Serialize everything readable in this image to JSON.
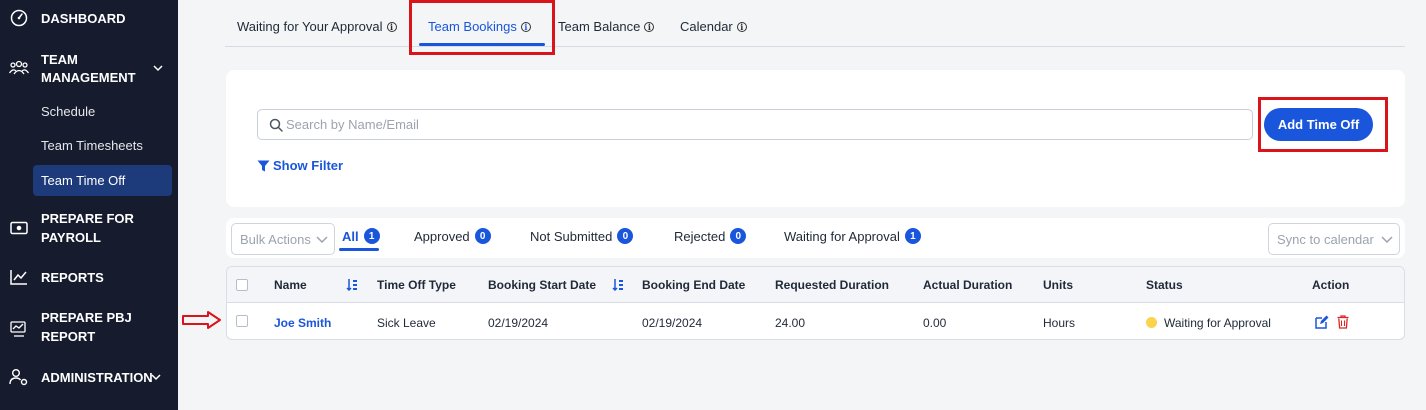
{
  "sidebar": {
    "dashboard": "DASHBOARD",
    "team_management": [
      "TEAM",
      "MANAGEMENT"
    ],
    "sub_items": [
      "Schedule",
      "Team Timesheets",
      "Team Time Off"
    ],
    "prepare_payroll": [
      "PREPARE FOR",
      "PAYROLL"
    ],
    "reports": "REPORTS",
    "prepare_pbj": [
      "PREPARE PBJ",
      "REPORT"
    ],
    "administration": "ADMINISTRATION"
  },
  "tabs": [
    "Waiting for Your Approval",
    "Team Bookings",
    "Team Balance",
    "Calendar"
  ],
  "tab_info_glyph": "i",
  "search": {
    "placeholder": "Search by Name/Email"
  },
  "buttons": {
    "add_time_off": "Add Time Off",
    "show_filter": "Show Filter"
  },
  "bulk_actions": "Bulk Actions",
  "sync_calendar": "Sync to calendar",
  "status_tabs": [
    {
      "label": "All",
      "count": "1"
    },
    {
      "label": "Approved",
      "count": "0"
    },
    {
      "label": "Not Submitted",
      "count": "0"
    },
    {
      "label": "Rejected",
      "count": "0"
    },
    {
      "label": "Waiting for Approval",
      "count": "1"
    }
  ],
  "table": {
    "headers": [
      "Name",
      "Time Off Type",
      "Booking Start Date",
      "Booking End Date",
      "Requested Duration",
      "Actual Duration",
      "Units",
      "Status",
      "Action"
    ],
    "rows": [
      {
        "name": "Joe Smith",
        "type": "Sick Leave",
        "start": "02/19/2024",
        "end": "02/19/2024",
        "requested": "24.00",
        "actual": "0.00",
        "units": "Hours",
        "status": "Waiting for Approval"
      }
    ]
  },
  "colors": {
    "sidebar_bg": "#161b2e",
    "accent": "#1a56db",
    "annotation_red": "#d9141b",
    "status_pending": "#fcd34d",
    "delete_red": "#e02424"
  }
}
